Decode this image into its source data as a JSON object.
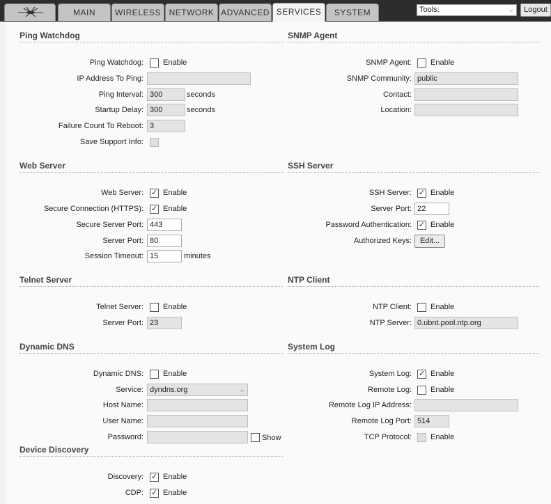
{
  "nav": {
    "tabs": [
      "MAIN",
      "WIRELESS",
      "NETWORK",
      "ADVANCED",
      "SERVICES",
      "SYSTEM"
    ],
    "active_tab": "SERVICES",
    "tools_select": "Tools:",
    "logout_label": "Logout"
  },
  "enable_label": "Enable",
  "ping_watchdog": {
    "title": "Ping Watchdog",
    "ping_watchdog_label": "Ping Watchdog:",
    "ip_label": "IP Address To Ping:",
    "ip_value": "",
    "interval_label": "Ping Interval:",
    "interval_value": "300",
    "interval_unit": "seconds",
    "startup_label": "Startup Delay:",
    "startup_value": "300",
    "startup_unit": "seconds",
    "failure_label": "Failure Count To Reboot:",
    "failure_value": "3",
    "support_label": "Save Support Info:"
  },
  "snmp": {
    "title": "SNMP Agent",
    "agent_label": "SNMP Agent:",
    "community_label": "SNMP Community:",
    "community_value": "public",
    "contact_label": "Contact:",
    "contact_value": "",
    "location_label": "Location:",
    "location_value": ""
  },
  "web_server": {
    "title": "Web Server",
    "server_label": "Web Server:",
    "secure_label": "Secure Connection (HTTPS):",
    "secure_port_label": "Secure Server Port:",
    "secure_port_value": "443",
    "port_label": "Server Port:",
    "port_value": "80",
    "timeout_label": "Session Timeout:",
    "timeout_value": "15",
    "timeout_unit": "minutes"
  },
  "ssh": {
    "title": "SSH Server",
    "server_label": "SSH Server:",
    "port_label": "Server Port:",
    "port_value": "22",
    "password_label": "Password Authentication:",
    "keys_label": "Authorized Keys:",
    "edit_button": "Edit..."
  },
  "telnet": {
    "title": "Telnet Server",
    "server_label": "Telnet Server:",
    "port_label": "Server Port:",
    "port_value": "23"
  },
  "ntp": {
    "title": "NTP Client",
    "client_label": "NTP Client:",
    "server_label": "NTP Server:",
    "server_value": "0.ubnt.pool.ntp.org"
  },
  "ddns": {
    "title": "Dynamic DNS",
    "ddns_label": "Dynamic DNS:",
    "service_label": "Service:",
    "service_value": "dyndns.org",
    "host_label": "Host Name:",
    "host_value": "",
    "user_label": "User Name:",
    "user_value": "",
    "password_label": "Password:",
    "password_value": "",
    "show_label": "Show"
  },
  "syslog": {
    "title": "System Log",
    "system_log_label": "System Log:",
    "remote_log_label": "Remote Log:",
    "remote_ip_label": "Remote Log IP Address:",
    "remote_ip_value": "",
    "remote_port_label": "Remote Log Port:",
    "remote_port_value": "514",
    "tcp_label": "TCP Protocol:"
  },
  "discovery": {
    "title": "Device Discovery",
    "discovery_label": "Discovery:",
    "cdp_label": "CDP:"
  },
  "checkmark": "✓"
}
